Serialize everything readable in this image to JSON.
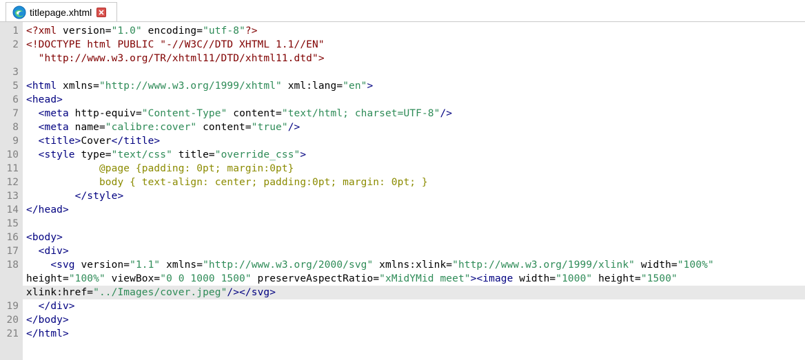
{
  "tab": {
    "filename": "titlepage.xhtml",
    "icon": "edge-browser-icon",
    "close_icon": "close-icon"
  },
  "colors": {
    "tag": "#000080",
    "attribute_value": "#2e8b57",
    "css": "#8b8b00",
    "gutter": "#e4e4e4",
    "current_line": "#e8e8e8",
    "close_button": "#d9534f"
  },
  "lines": [
    {
      "n": "1",
      "tokens": [
        [
          "p",
          "<?xml "
        ],
        [
          "a",
          "version="
        ],
        [
          "v",
          "\"1.0\""
        ],
        [
          "a",
          " encoding="
        ],
        [
          "v",
          "\"utf-8\""
        ],
        [
          "p",
          "?>"
        ]
      ]
    },
    {
      "n": "2",
      "tokens": [
        [
          "p",
          "<!DOCTYPE html PUBLIC \"-//W3C//DTD XHTML 1.1//EN\""
        ]
      ]
    },
    {
      "n": "",
      "tokens": [
        [
          "p",
          "  \"http://www.w3.org/TR/xhtml11/DTD/xhtml11.dtd\">"
        ]
      ]
    },
    {
      "n": "3",
      "tokens": []
    },
    {
      "n": "5",
      "tokens": [
        [
          "t",
          "<html "
        ],
        [
          "a",
          "xmlns="
        ],
        [
          "v",
          "\"http://www.w3.org/1999/xhtml\""
        ],
        [
          "a",
          " xml:lang="
        ],
        [
          "v",
          "\"en\""
        ],
        [
          "t",
          ">"
        ]
      ]
    },
    {
      "n": "6",
      "tokens": [
        [
          "t",
          "<head>"
        ]
      ]
    },
    {
      "n": "7",
      "tokens": [
        [
          "t",
          "  <meta "
        ],
        [
          "a",
          "http-equiv="
        ],
        [
          "v",
          "\"Content-Type\""
        ],
        [
          "a",
          " content="
        ],
        [
          "v",
          "\"text/html; charset=UTF-8\""
        ],
        [
          "t",
          "/>"
        ]
      ]
    },
    {
      "n": "8",
      "tokens": [
        [
          "t",
          "  <meta "
        ],
        [
          "a",
          "name="
        ],
        [
          "v",
          "\"calibre:cover\""
        ],
        [
          "a",
          " content="
        ],
        [
          "v",
          "\"true\""
        ],
        [
          "t",
          "/>"
        ]
      ]
    },
    {
      "n": "9",
      "tokens": [
        [
          "t",
          "  <title>"
        ],
        [
          "x",
          "Cover"
        ],
        [
          "t",
          "</title>"
        ]
      ]
    },
    {
      "n": "10",
      "tokens": [
        [
          "t",
          "  <style "
        ],
        [
          "a",
          "type="
        ],
        [
          "v",
          "\"text/css\""
        ],
        [
          "a",
          " title="
        ],
        [
          "v",
          "\"override_css\""
        ],
        [
          "t",
          ">"
        ]
      ]
    },
    {
      "n": "11",
      "tokens": [
        [
          "s",
          "            @page {padding: 0pt; margin:0pt}"
        ]
      ]
    },
    {
      "n": "12",
      "tokens": [
        [
          "s",
          "            body { text-align: center; padding:0pt; margin: 0pt; }"
        ]
      ]
    },
    {
      "n": "13",
      "tokens": [
        [
          "t",
          "        </style>"
        ]
      ]
    },
    {
      "n": "14",
      "tokens": [
        [
          "t",
          "</head>"
        ]
      ]
    },
    {
      "n": "15",
      "tokens": []
    },
    {
      "n": "16",
      "tokens": [
        [
          "t",
          "<body>"
        ]
      ]
    },
    {
      "n": "17",
      "tokens": [
        [
          "t",
          "  <div>"
        ]
      ]
    },
    {
      "n": "18",
      "tokens": [
        [
          "t",
          "    <svg "
        ],
        [
          "a",
          "version="
        ],
        [
          "v",
          "\"1.1\""
        ],
        [
          "a",
          " xmlns="
        ],
        [
          "v",
          "\"http://www.w3.org/2000/svg\""
        ],
        [
          "a",
          " xmlns:xlink="
        ],
        [
          "v",
          "\"http://www.w3.org/1999/xlink\""
        ],
        [
          "a",
          " width="
        ],
        [
          "v",
          "\"100%\""
        ]
      ]
    },
    {
      "n": "",
      "tokens": [
        [
          "a",
          "height="
        ],
        [
          "v",
          "\"100%\""
        ],
        [
          "a",
          " viewBox="
        ],
        [
          "v",
          "\"0 0 1000 1500\""
        ],
        [
          "a",
          " preserveAspectRatio="
        ],
        [
          "v",
          "\"xMidYMid meet\""
        ],
        [
          "t",
          ">"
        ],
        [
          "t",
          "<image "
        ],
        [
          "a",
          "width="
        ],
        [
          "v",
          "\"1000\""
        ],
        [
          "a",
          " height="
        ],
        [
          "v",
          "\"1500\""
        ]
      ]
    },
    {
      "n": "",
      "tokens": [
        [
          "a",
          "xlink:href="
        ],
        [
          "v",
          "\"../Images/cover.jpeg\""
        ],
        [
          "t",
          "/>"
        ],
        [
          "t",
          "</svg>"
        ]
      ],
      "current": true
    },
    {
      "n": "19",
      "tokens": [
        [
          "t",
          "  </div>"
        ]
      ]
    },
    {
      "n": "20",
      "tokens": [
        [
          "t",
          "</body>"
        ]
      ]
    },
    {
      "n": "21",
      "tokens": [
        [
          "t",
          "</html>"
        ]
      ]
    }
  ]
}
